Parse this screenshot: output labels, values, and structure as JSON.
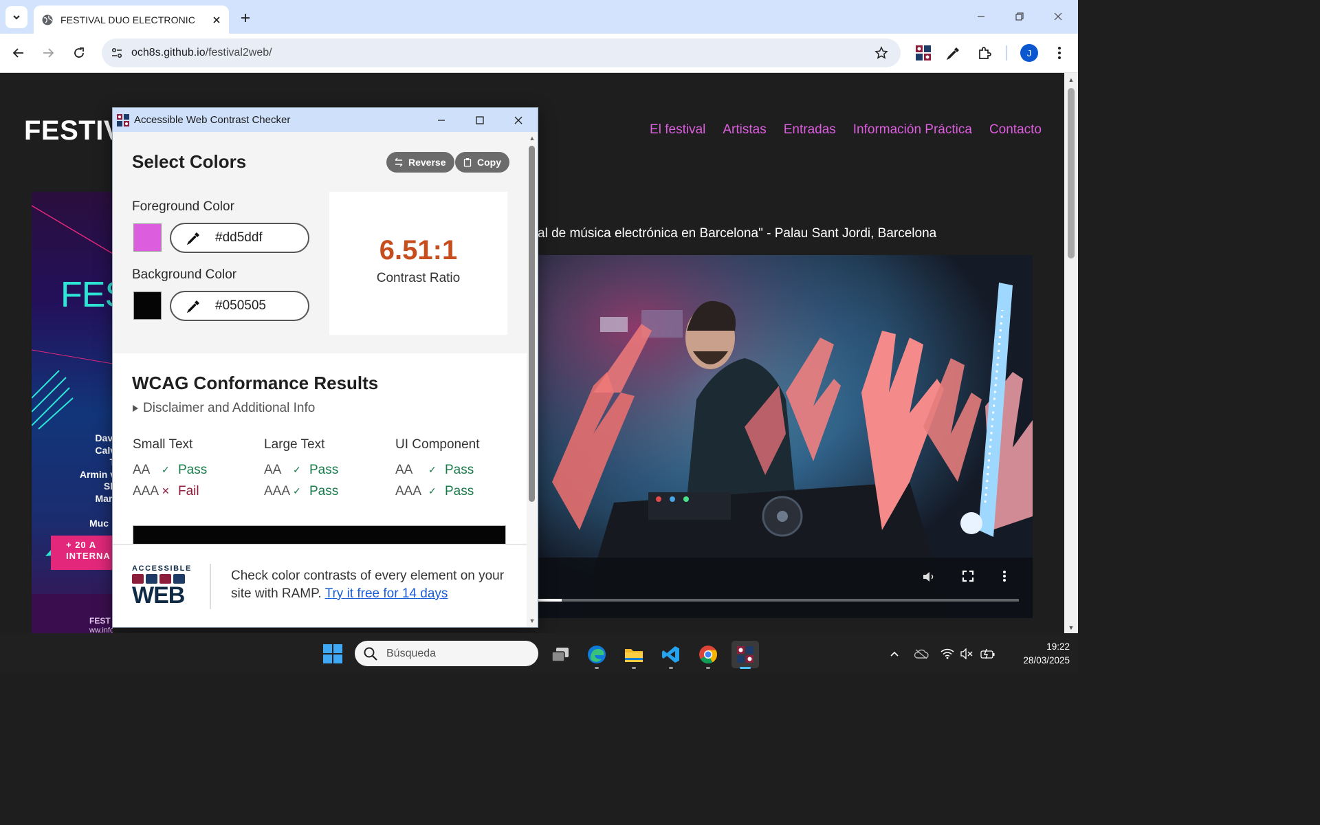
{
  "browser": {
    "tab_title": "FESTIVAL DUO ELECTRONIC",
    "url_host": "och8s.github.io",
    "url_path": "/festival2web/",
    "profile_initial": "J"
  },
  "site": {
    "title": "FESTIV",
    "nav": [
      "El festival",
      "Artistas",
      "Entradas",
      "Información Práctica",
      "Contacto"
    ],
    "caption": "al de música electrónica en Barcelona\" - Palau Sant Jordi, Barcelona",
    "poster": {
      "title": "FES",
      "artists": [
        "Davi",
        "Calv",
        "T",
        "Armin v",
        "Sk",
        "Mart"
      ],
      "more": "Muc",
      "badge_line1": "+ 20 A",
      "badge_line2": "INTERNA",
      "footer_name": "FEST",
      "footer_email": "ww.info@fest.org"
    }
  },
  "popup": {
    "window_title": "Accessible Web Contrast Checker",
    "select_title": "Select Colors",
    "reverse_label": "Reverse",
    "copy_label": "Copy",
    "foreground_label": "Foreground Color",
    "foreground_hex": "#dd5ddf",
    "background_label": "Background Color",
    "background_hex": "#050505",
    "ratio": "6.51:1",
    "ratio_label": "Contrast Ratio",
    "wcag_title": "WCAG Conformance Results",
    "disclaimer": "Disclaimer and Additional Info",
    "results": [
      {
        "head": "Small Text",
        "rows": [
          {
            "level": "AA",
            "result": "Pass"
          },
          {
            "level": "AAA",
            "result": "Fail"
          }
        ]
      },
      {
        "head": "Large Text",
        "rows": [
          {
            "level": "AA",
            "result": "Pass"
          },
          {
            "level": "AAA",
            "result": "Pass"
          }
        ]
      },
      {
        "head": "UI Component",
        "rows": [
          {
            "level": "AA",
            "result": "Pass"
          },
          {
            "level": "AAA",
            "result": "Pass"
          }
        ]
      }
    ],
    "logo_top": "ACCESSIBLE",
    "logo_main": "WEB",
    "footer_text": "Check color contrasts of every element on your site with RAMP.",
    "footer_link": "Try it free for 14 days"
  },
  "taskbar": {
    "search_placeholder": "Búsqueda",
    "time": "19:22",
    "date": "28/03/2025"
  },
  "colors": {
    "foreground": "#dd5ddf",
    "background": "#050505",
    "ratio_color": "#c54d1e",
    "pass": "#1a7a4a",
    "fail": "#8f1c3a"
  }
}
